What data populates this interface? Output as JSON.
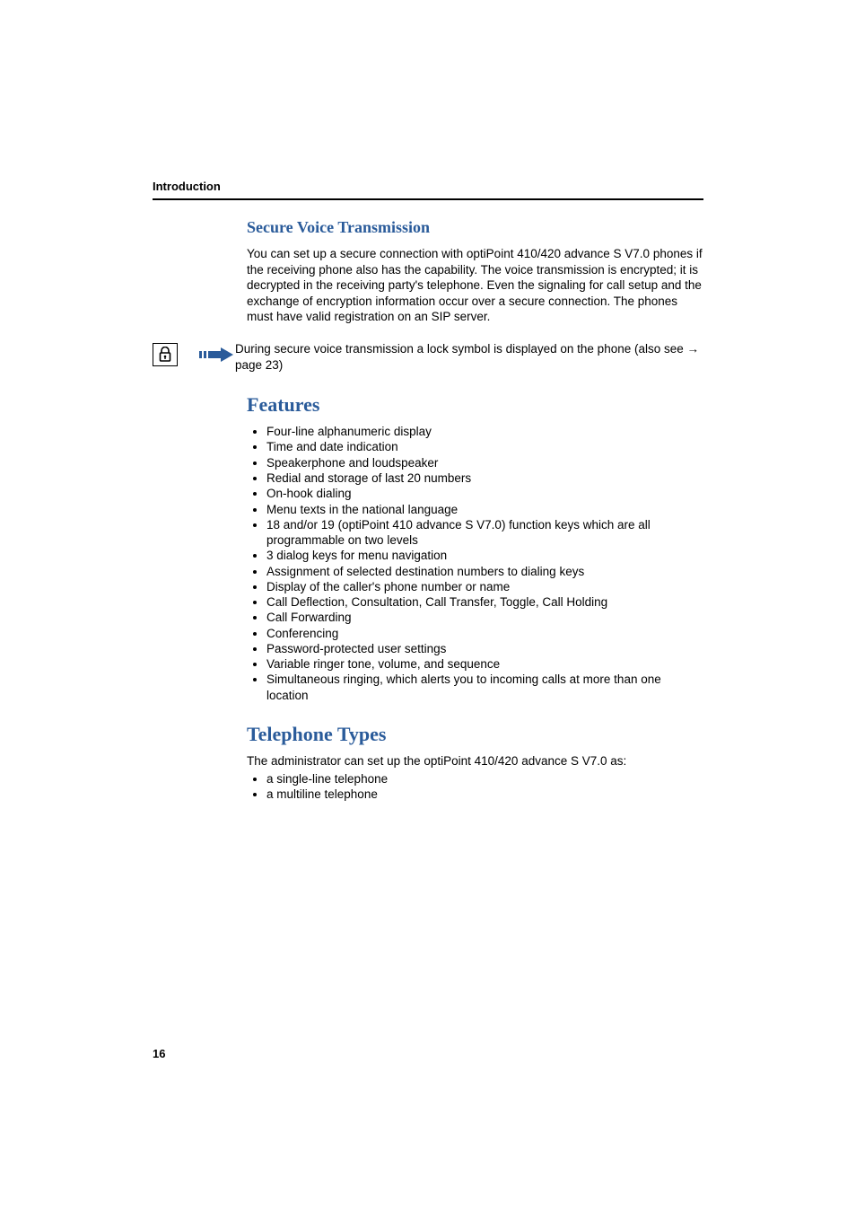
{
  "header": {
    "running": "Introduction"
  },
  "section1": {
    "title": "Secure Voice Transmission",
    "para": "You can set up a secure connection with optiPoint 410/420 advance S V7.0 phones if the receiving phone also has the capability. The voice transmission is encrypted; it is decrypted in the receiving party's telephone. Even the signaling for call setup and the exchange of encryption information occur over a secure connection. The phones must have valid registration on an SIP server."
  },
  "note": {
    "text_a": "During secure voice transmission a lock symbol is displayed on the phone (also see ",
    "arrow": "→",
    "text_b": " page 23)"
  },
  "features": {
    "title": "Features",
    "items": [
      "Four-line alphanumeric display",
      "Time and date indication",
      "Speakerphone and loudspeaker",
      "Redial and storage of last 20 numbers",
      "On-hook dialing",
      "Menu texts in the national language",
      "18 and/or 19 (optiPoint 410 advance S V7.0) function keys which are all programmable on two levels",
      "3 dialog keys for menu navigation",
      "Assignment of selected destination numbers to dialing keys",
      "Display of the caller's phone number or name",
      "Call Deflection, Consultation, Call Transfer, Toggle, Call Holding",
      "Call Forwarding",
      "Conferencing",
      "Password-protected user settings",
      "Variable ringer tone, volume, and sequence",
      "Simultaneous ringing, which alerts you to incoming calls at more than one location"
    ]
  },
  "telephone": {
    "title": "Telephone Types",
    "intro": "The administrator can set up the optiPoint 410/420 advance S V7.0 as:",
    "items": [
      "a single-line telephone",
      "a multiline telephone"
    ]
  },
  "footer": {
    "page": "16"
  }
}
